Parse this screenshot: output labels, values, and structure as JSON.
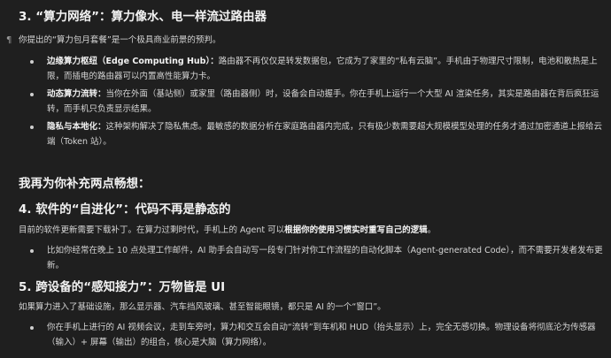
{
  "sec3": {
    "title": "3. “算力网络”：算力像水、电一样流过路由器",
    "pilcrow": "¶",
    "intro": "你提出的“算力包月套餐”是一个极具商业前景的预判。",
    "items": [
      {
        "label": "边缘算力枢纽（Edge Computing Hub）：",
        "text": "路由器不再仅仅是转发数据包，它成为了家里的“私有云脑”。手机由于物理尺寸限制，电池和散热是上限，而插电的路由器可以内置高性能算力卡。"
      },
      {
        "label": "动态算力流转：",
        "text": "当你在外面（基站侧）或家里（路由器侧）时，设备会自动握手。你在手机上运行一个大型 AI 渲染任务，其实是路由器在背后疯狂运转，而手机只负责显示结果。"
      },
      {
        "label": "隐私与本地化：",
        "text": "这种架构解决了隐私焦虑。最敏感的数据分析在家庭路由器内完成，只有极少数需要超大规模模型处理的任务才通过加密通道上报给云端（Token 站）。"
      }
    ]
  },
  "extra_heading": "我再为你补充两点畅想：",
  "sec4": {
    "title": "4. 软件的“自进化”：代码不再是静态的",
    "intro_plain": "目前的软件更新需要下载补丁。在算力过剩时代，手机上的 Agent 可以",
    "intro_bold": "根据你的使用习惯实时重写自己的逻辑",
    "intro_end": "。",
    "item": "比如你经常在晚上 10 点处理工作邮件，AI 助手会自动写一段专门针对你工作流程的自动化脚本（Agent-generated Code），而不需要开发者发布更新。"
  },
  "sec5": {
    "title": "5. 跨设备的“感知接力”：万物皆是 UI",
    "intro": "如果算力进入了基础设施，那么显示器、汽车挡风玻璃、甚至智能眼镜，都只是 AI 的一个“窗口”。",
    "item": "你在手机上进行的 AI 视频会议，走到车旁时，算力和交互会自动“流转”到车机和 HUD（抬头显示）上，完全无感切换。物理设备将彻底沦为传感器（输入）+ 屏幕（输出）的组合，核心是大脑（算力网络）。"
  }
}
